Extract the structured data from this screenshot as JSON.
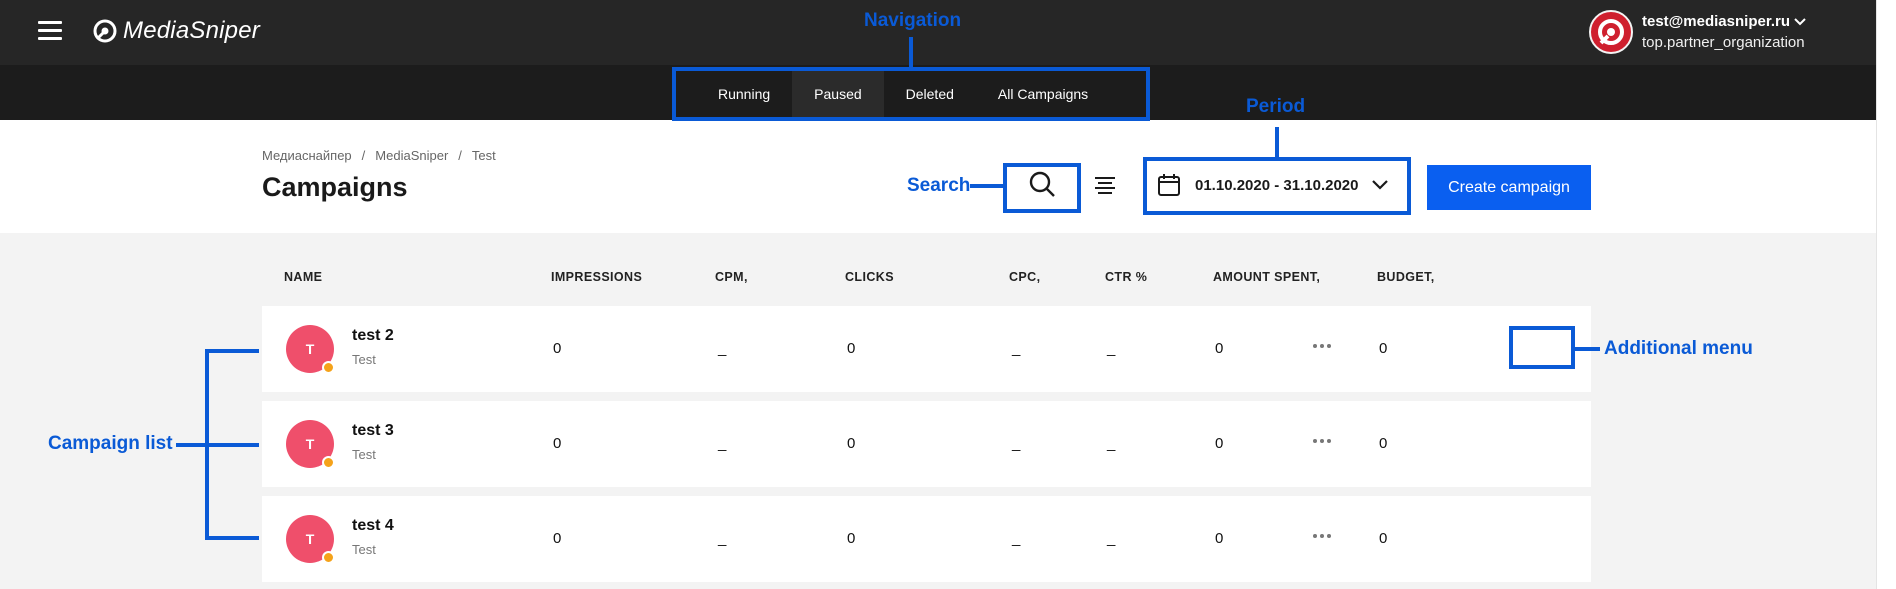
{
  "app": {
    "logo_text": "MediaSniper",
    "account_email": "test@mediasniper.ru",
    "account_org": "top.partner_organization"
  },
  "nav": {
    "tabs": [
      {
        "label": "Running",
        "active": false
      },
      {
        "label": "Paused",
        "active": true
      },
      {
        "label": "Deleted",
        "active": false
      },
      {
        "label": "All Campaigns",
        "active": false
      }
    ]
  },
  "header": {
    "breadcrumb": [
      "Медиаснайпер",
      "MediaSniper",
      "Test"
    ],
    "breadcrumb_separator": "/",
    "title": "Campaigns",
    "period": "01.10.2020 - 31.10.2020",
    "create_button": "Create campaign"
  },
  "table": {
    "columns": [
      "NAME",
      "IMPRESSIONS",
      "CPM,",
      "CLICKS",
      "CPC,",
      "CTR %",
      "AMOUNT SPENT,",
      "BUDGET,"
    ],
    "rows": [
      {
        "initial": "T",
        "name": "test 2",
        "subtitle": "Test",
        "impressions": "0",
        "cpm": "_",
        "clicks": "0",
        "cpc": "_",
        "ctr": "_",
        "amount_spent": "0",
        "budget": "0"
      },
      {
        "initial": "T",
        "name": "test 3",
        "subtitle": "Test",
        "impressions": "0",
        "cpm": "_",
        "clicks": "0",
        "cpc": "_",
        "ctr": "_",
        "amount_spent": "0",
        "budget": "0"
      },
      {
        "initial": "T",
        "name": "test 4",
        "subtitle": "Test",
        "impressions": "0",
        "cpm": "_",
        "clicks": "0",
        "cpc": "_",
        "ctr": "_",
        "amount_spent": "0",
        "budget": "0"
      }
    ]
  },
  "annotations": {
    "navigation": "Navigation",
    "period": "Period",
    "search": "Search",
    "additional_menu": "Additional menu",
    "campaign_list": "Campaign list"
  },
  "colors": {
    "topbar": "#262626",
    "subbar": "#1c1c1c",
    "accent": "#0a5ff0",
    "annotation": "#0a5ad6",
    "avatar": "#ef4f6b",
    "status_dot": "#f5a21a"
  },
  "icons": {
    "menu": "hamburger-icon",
    "search": "search-icon",
    "filter": "filter-icon",
    "calendar": "calendar-icon",
    "chevron": "chevron-down-icon",
    "more": "more-dots-icon"
  }
}
